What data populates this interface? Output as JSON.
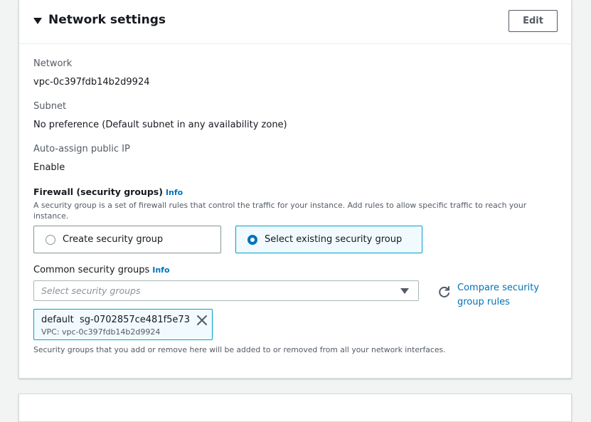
{
  "section": {
    "title": "Network settings",
    "edit_label": "Edit"
  },
  "fields": {
    "network": {
      "label": "Network",
      "value": "vpc-0c397fdb14b2d9924"
    },
    "subnet": {
      "label": "Subnet",
      "value": "No preference (Default subnet in any availability zone)"
    },
    "auto_ip": {
      "label": "Auto-assign public IP",
      "value": "Enable"
    }
  },
  "firewall": {
    "title": "Firewall (security groups)",
    "info": "Info",
    "description": "A security group is a set of firewall rules that control the traffic for your instance. Add rules to allow specific traffic to reach your instance.",
    "options": [
      {
        "label": "Create security group",
        "selected": false
      },
      {
        "label": "Select existing security group",
        "selected": true
      }
    ]
  },
  "common_groups": {
    "label": "Common security groups",
    "info": "Info",
    "placeholder": "Select security groups",
    "compare_link": "Compare security group rules",
    "token": {
      "name": "default",
      "id": "sg-0702857ce481f5e73",
      "vpc": "VPC: vpc-0c397fdb14b2d9924"
    },
    "help": "Security groups that you add or remove here will be added to or removed from all your network interfaces."
  },
  "colors": {
    "link": "#0073bb",
    "selected_border": "#00a1c9",
    "selected_bg": "#f1faff"
  }
}
